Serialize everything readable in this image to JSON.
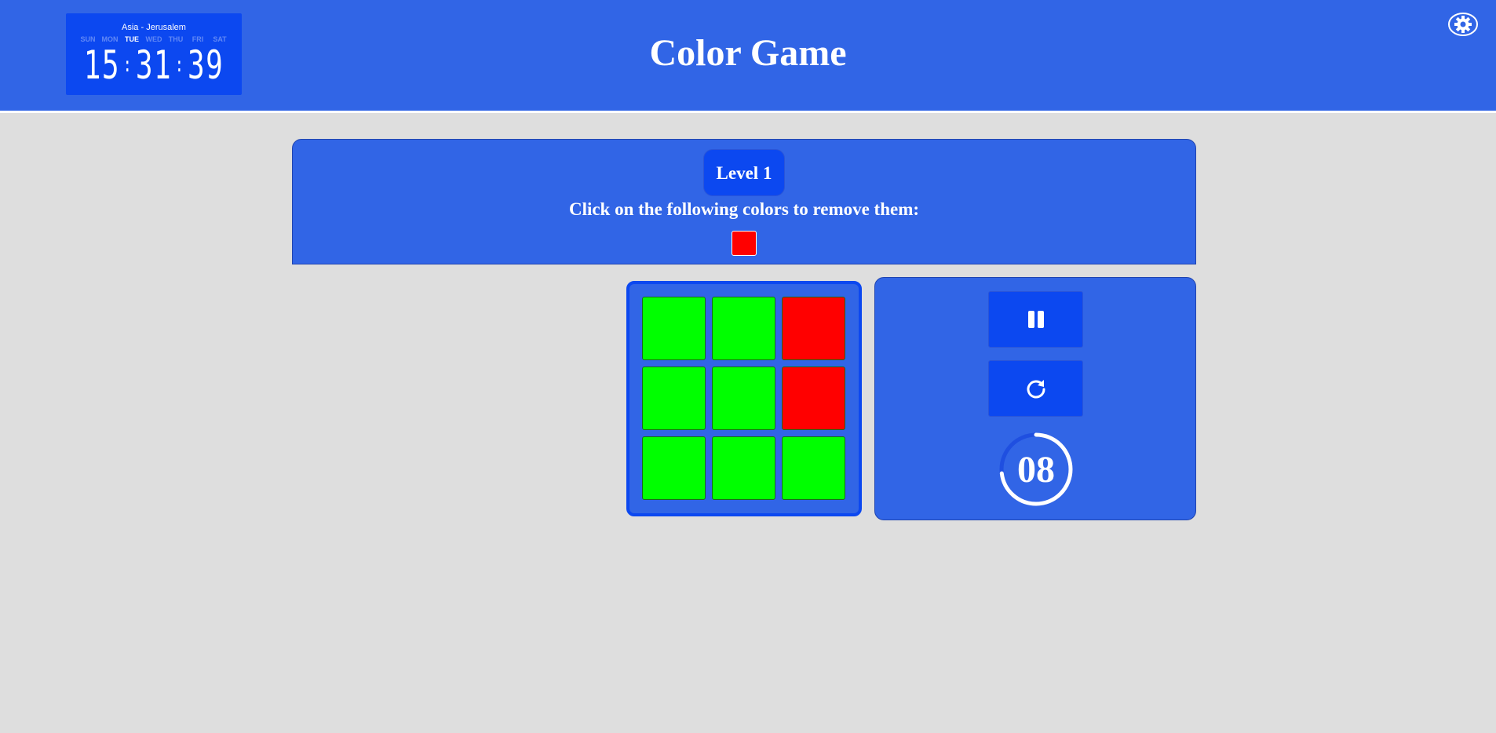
{
  "header": {
    "title": "Color Game",
    "settings_icon": "gear-icon"
  },
  "clock": {
    "timezone": "Asia - Jerusalem",
    "days": [
      "SUN",
      "MON",
      "TUE",
      "WED",
      "THU",
      "FRI",
      "SAT"
    ],
    "active_day": "TUE",
    "hours": "15",
    "minutes": "31",
    "seconds": "39"
  },
  "instructions": {
    "level_label": "Level 1",
    "prompt": "Click on the following colors to remove them:",
    "target_colors": [
      "#ff0000"
    ]
  },
  "board": {
    "rows": 3,
    "cols": 3,
    "tiles": [
      "#00ff00",
      "#00ff00",
      "#ff0000",
      "#00ff00",
      "#00ff00",
      "#ff0000",
      "#00ff00",
      "#00ff00",
      "#00ff00"
    ]
  },
  "controls": {
    "pause_icon": "pause-icon",
    "restart_icon": "restart-icon",
    "timer_value": "08",
    "timer_fraction_remaining": 0.73
  },
  "colors": {
    "header_bg": "#3165e6",
    "accent_dark": "#0c48f0",
    "page_bg": "#dedede",
    "red": "#ff0000",
    "green": "#00ff00"
  }
}
